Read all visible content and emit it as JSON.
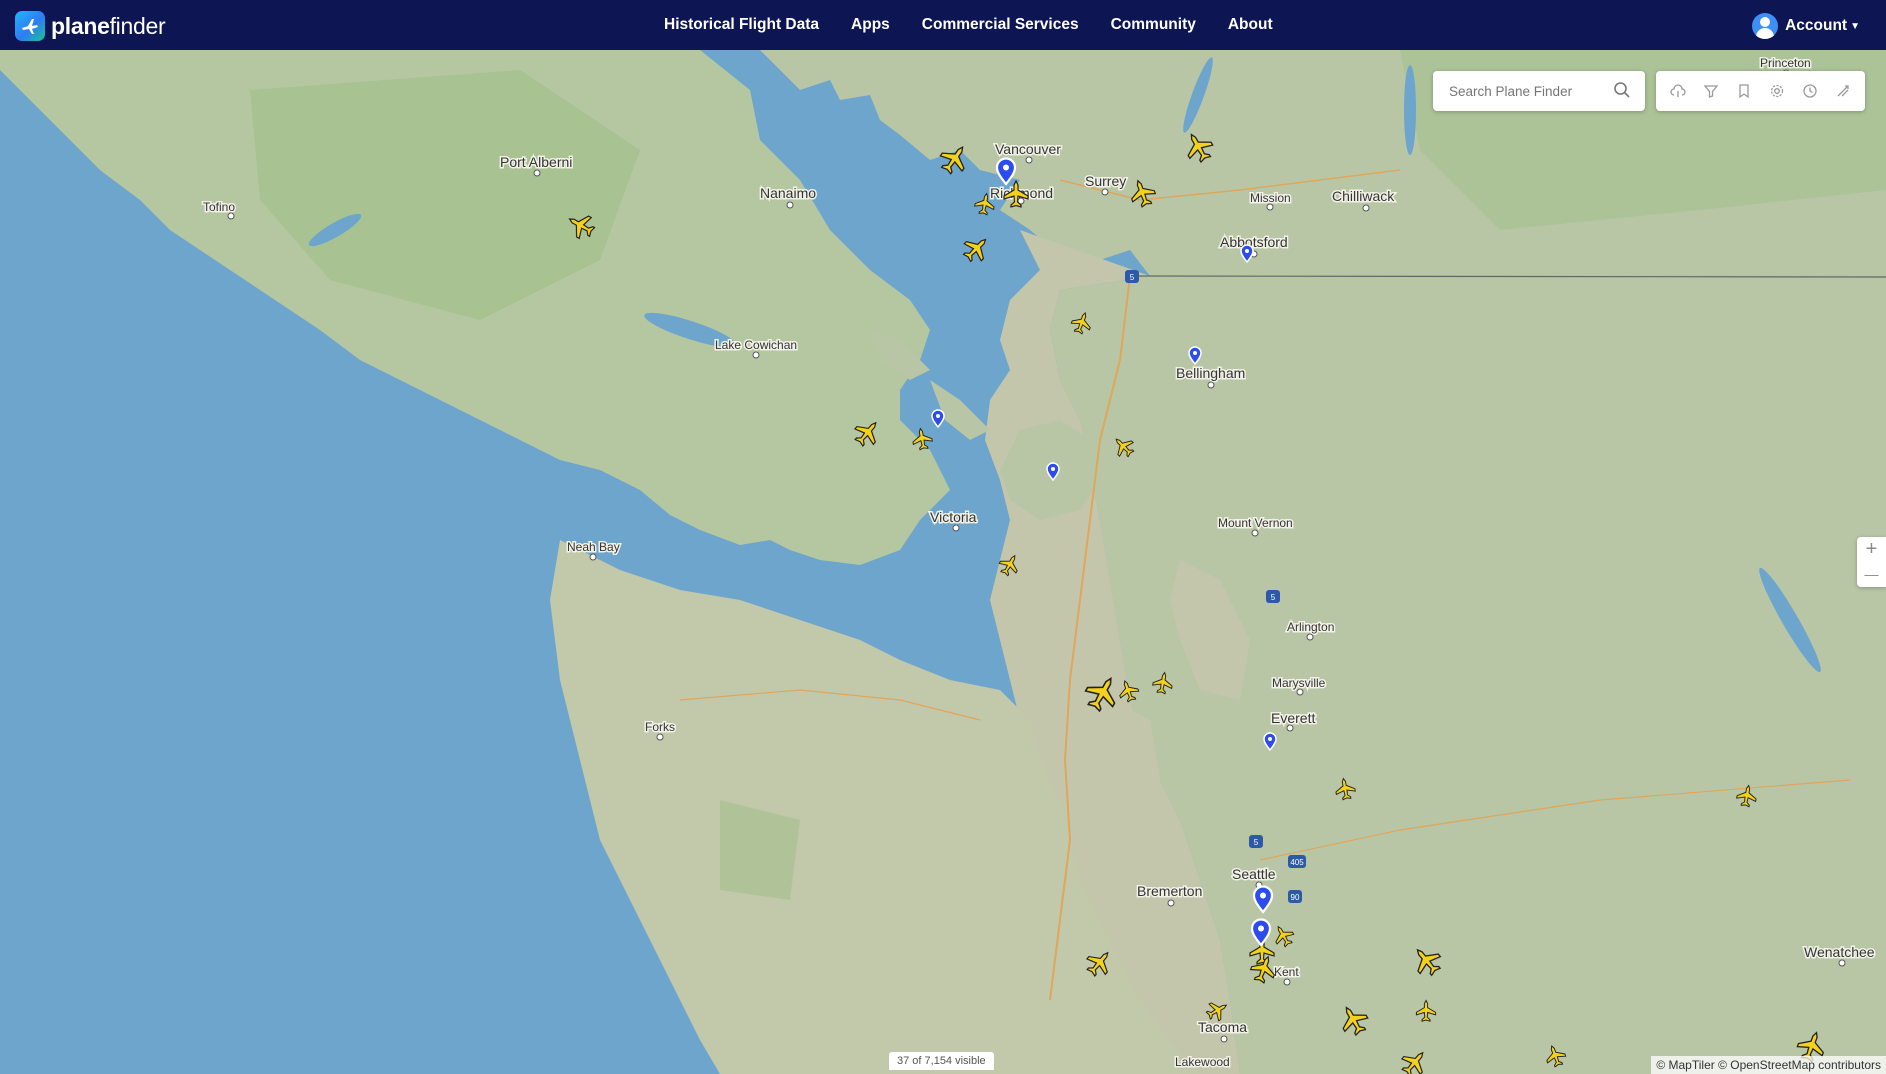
{
  "brand": {
    "name_bold": "plane",
    "name_rest": "finder"
  },
  "nav": {
    "items": [
      "Historical Flight Data",
      "Apps",
      "Commercial Services",
      "Community",
      "About"
    ],
    "account_label": "Account"
  },
  "search": {
    "placeholder": "Search Plane Finder"
  },
  "toolbar": {
    "icons": [
      "cloud-icon",
      "filter-icon",
      "bookmark-icon",
      "settings-icon",
      "history-icon",
      "broadcast-icon"
    ]
  },
  "zoom": {
    "in_label": "+",
    "out_label": "—"
  },
  "status": {
    "visible_count": "37 of 7,154 visible"
  },
  "attribution": "© MapTiler © OpenStreetMap contributors",
  "colors": {
    "nav_bg": "#0d1552",
    "water": "#6ea5cc",
    "land": "#b5c4a6",
    "forest": "#a3c08c",
    "aircraft": "#f5d21a",
    "marker": "#2d4cf0"
  },
  "map": {
    "places": [
      {
        "name": "Vancouver",
        "size": "city"
      },
      {
        "name": "Richmond",
        "size": "city"
      },
      {
        "name": "Surrey",
        "size": "city"
      },
      {
        "name": "Chilliwack",
        "size": "city"
      },
      {
        "name": "Mission",
        "size": "town"
      },
      {
        "name": "Abbotsford",
        "size": "city"
      },
      {
        "name": "Nanaimo",
        "size": "city"
      },
      {
        "name": "Port Alberni",
        "size": "city"
      },
      {
        "name": "Tofino",
        "size": "town"
      },
      {
        "name": "Lake Cowichan",
        "size": "town"
      },
      {
        "name": "Bellingham",
        "size": "city"
      },
      {
        "name": "Victoria",
        "size": "city"
      },
      {
        "name": "Mount Vernon",
        "size": "town"
      },
      {
        "name": "Neah Bay",
        "size": "town"
      },
      {
        "name": "Arlington",
        "size": "town"
      },
      {
        "name": "Marysville",
        "size": "town"
      },
      {
        "name": "Everett",
        "size": "city"
      },
      {
        "name": "Forks",
        "size": "town"
      },
      {
        "name": "Seattle",
        "size": "city"
      },
      {
        "name": "Bremerton",
        "size": "city"
      },
      {
        "name": "Kent",
        "size": "town"
      },
      {
        "name": "Tacoma",
        "size": "city"
      },
      {
        "name": "Lakewood",
        "size": "town"
      },
      {
        "name": "Wenatchee",
        "size": "city"
      },
      {
        "name": "Princeton",
        "size": "town"
      }
    ],
    "highways": [
      "5",
      "5",
      "5",
      "405",
      "90"
    ]
  }
}
